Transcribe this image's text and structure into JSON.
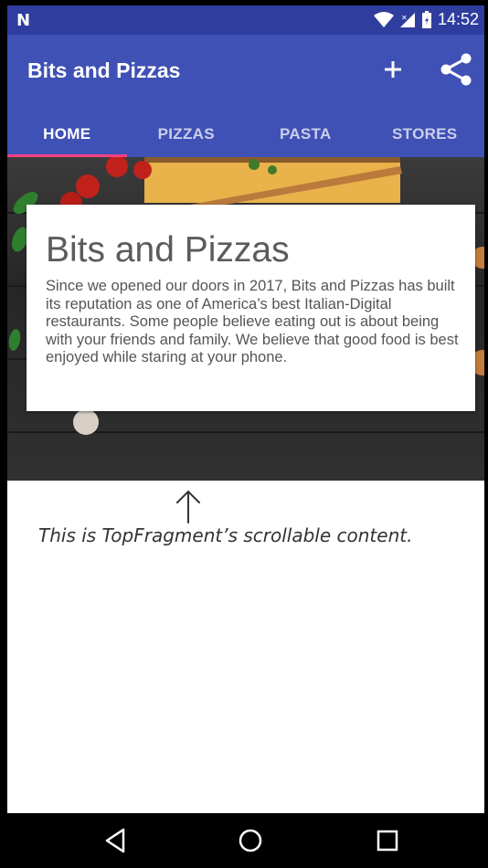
{
  "status_bar": {
    "time": "14:52",
    "carrier_icon": "n-logo-icon",
    "wifi_icon": "wifi-icon",
    "signal_icon": "signal-icon",
    "battery_icon": "battery-icon"
  },
  "app_bar": {
    "title": "Bits and Pizzas",
    "add_icon": "plus-icon",
    "share_icon": "share-icon",
    "color": "#3f51b5",
    "status_color": "#2f3e9e"
  },
  "tabs": [
    {
      "label": "HOME",
      "active": true
    },
    {
      "label": "PIZZAS",
      "active": false
    },
    {
      "label": "PASTA",
      "active": false
    },
    {
      "label": "STORES",
      "active": false
    }
  ],
  "tab_indicator_color": "#ff4081",
  "card": {
    "heading": "Bits and Pizzas",
    "body": "Since we opened our doors in 2017, Bits and Pizzas has built its reputation as one of America’s best Italian-Digital restaurants. Some people believe eating out is about being with your friends and family. We believe that good food is best enjoyed while staring at your phone."
  },
  "annotation": {
    "text": "This is TopFragment’s scrollable content."
  },
  "nav_bar": {
    "back_icon": "back-triangle-icon",
    "home_icon": "home-circle-icon",
    "recents_icon": "recents-square-icon"
  }
}
